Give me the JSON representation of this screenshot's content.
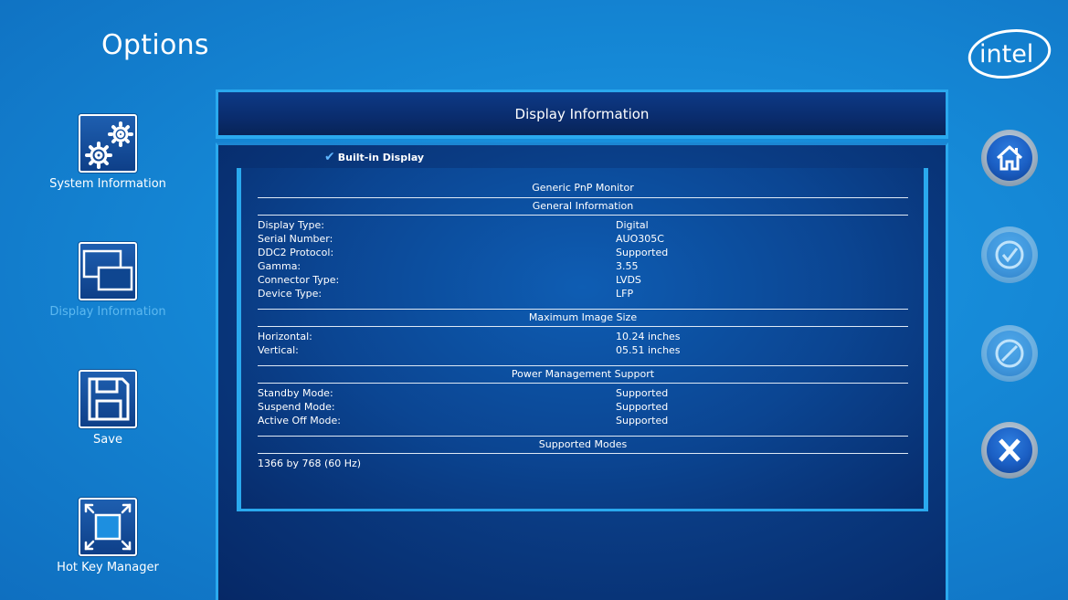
{
  "app": {
    "title": "Options",
    "logo_text": "intel"
  },
  "sidebar": {
    "items": [
      {
        "label": "System Information",
        "icon": "gears-icon"
      },
      {
        "label": "Display Information",
        "icon": "display-windows-icon",
        "active": true
      },
      {
        "label": "Save",
        "icon": "floppy-disk-icon"
      },
      {
        "label": "Hot Key Manager",
        "icon": "expand-arrows-icon"
      }
    ]
  },
  "panel": {
    "title": "Display Information",
    "device": "Built-in Display",
    "monitor_name": "Generic PnP Monitor",
    "sections": {
      "general": {
        "title": "General Information",
        "rows": [
          {
            "key": "Display Type:",
            "value": "Digital"
          },
          {
            "key": "Serial Number:",
            "value": "AUO305C"
          },
          {
            "key": "DDC2 Protocol:",
            "value": "Supported"
          },
          {
            "key": "Gamma:",
            "value": "3.55"
          },
          {
            "key": "Connector Type:",
            "value": "LVDS"
          },
          {
            "key": "Device Type:",
            "value": "LFP"
          }
        ]
      },
      "image_size": {
        "title": "Maximum Image Size",
        "rows": [
          {
            "key": "Horizontal:",
            "value": "10.24 inches"
          },
          {
            "key": "Vertical:",
            "value": "05.51 inches"
          }
        ]
      },
      "power": {
        "title": "Power Management Support",
        "rows": [
          {
            "key": "Standby Mode:",
            "value": "Supported"
          },
          {
            "key": "Suspend Mode:",
            "value": "Supported"
          },
          {
            "key": "Active Off Mode:",
            "value": "Supported"
          }
        ]
      },
      "modes": {
        "title": "Supported Modes",
        "items": [
          "1366 by 768 (60 Hz)"
        ]
      }
    }
  },
  "actions": [
    {
      "name": "home",
      "icon": "home-icon",
      "enabled": true
    },
    {
      "name": "apply",
      "icon": "check-circle-icon",
      "enabled": false
    },
    {
      "name": "cancel",
      "icon": "cancel-circle-icon",
      "enabled": false
    },
    {
      "name": "close",
      "icon": "x-icon",
      "enabled": true
    }
  ],
  "colors": {
    "accent": "#2aa9ee",
    "background": "#1588d6",
    "panel": "#0a3c84",
    "active_label": "#5cb8f0"
  }
}
